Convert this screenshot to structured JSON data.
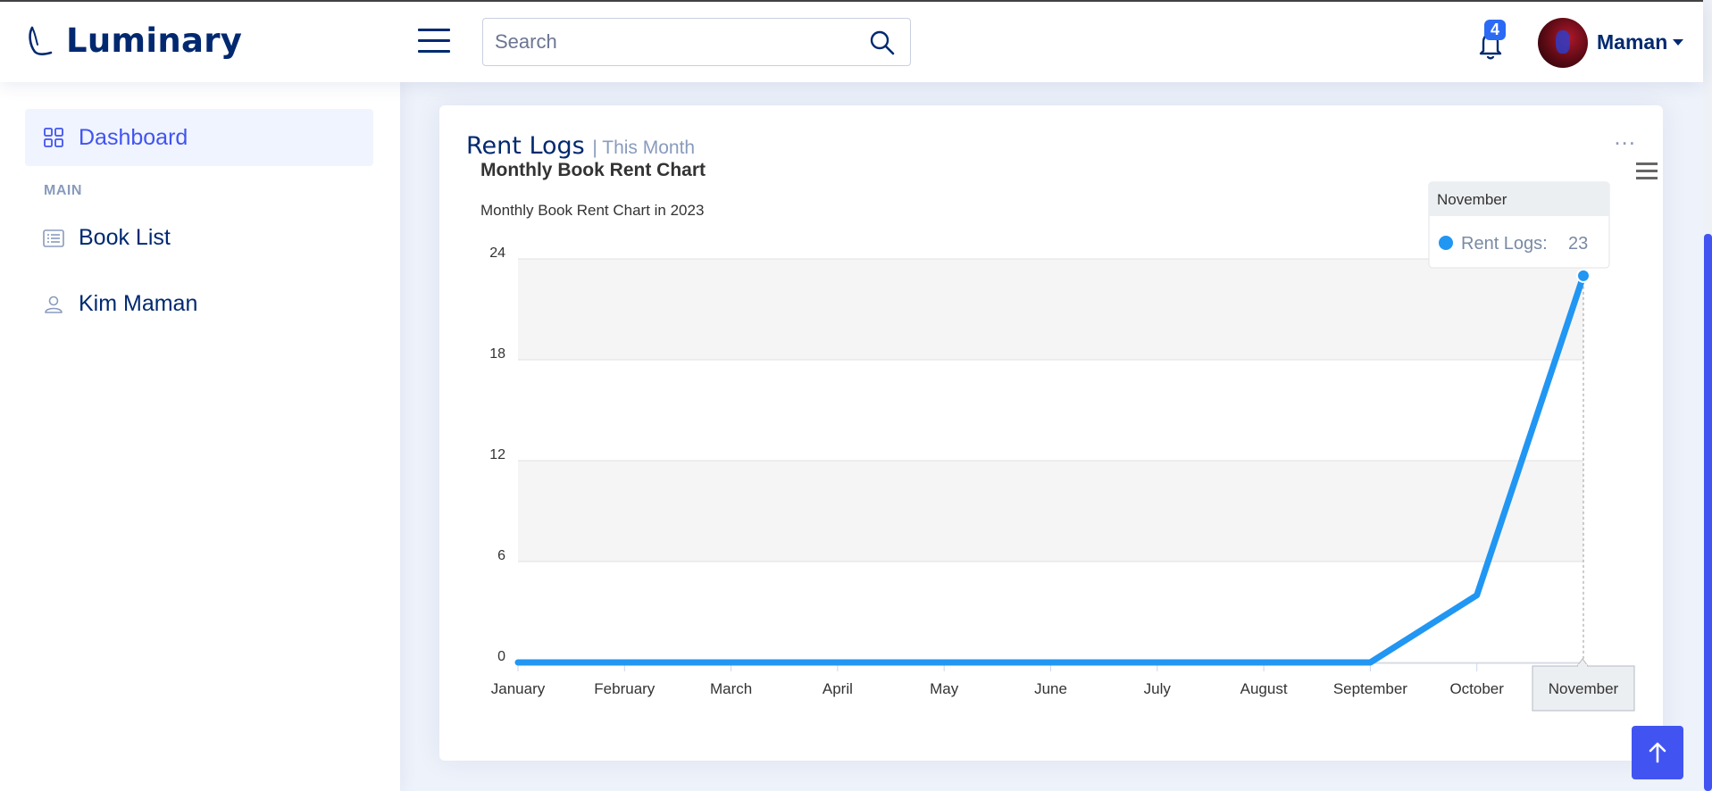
{
  "header": {
    "brand": "Luminary",
    "search_placeholder": "Search",
    "notification_count": "4",
    "user_name": "Maman"
  },
  "sidebar": {
    "active_item": "Dashboard",
    "section_heading": "MAIN",
    "items": [
      {
        "label": "Book List",
        "icon": "list-icon"
      },
      {
        "label": "Kim Maman",
        "icon": "person-icon"
      }
    ]
  },
  "card": {
    "title": "Rent Logs",
    "subtitle": "| This Month",
    "menu": "..."
  },
  "tooltip": {
    "header": "November",
    "series_label": "Rent Logs:",
    "value": "23"
  },
  "crosshair_label": "November",
  "colors": {
    "accent": "#4154f1",
    "navy": "#012970",
    "series": "#2196f3"
  },
  "chart_data": {
    "type": "line",
    "title": "Monthly Book Rent Chart",
    "subtitle": "Monthly Book Rent Chart in 2023",
    "categories": [
      "January",
      "February",
      "March",
      "April",
      "May",
      "June",
      "July",
      "August",
      "September",
      "October",
      "November"
    ],
    "series": [
      {
        "name": "Rent Logs",
        "values": [
          0,
          0,
          0,
          0,
          0,
          0,
          0,
          0,
          0,
          4,
          23
        ]
      }
    ],
    "yticks": [
      0,
      6,
      12,
      18,
      24
    ],
    "ylim": [
      0,
      24
    ],
    "grid": true,
    "legend": "none",
    "xlabel": "",
    "ylabel": ""
  }
}
